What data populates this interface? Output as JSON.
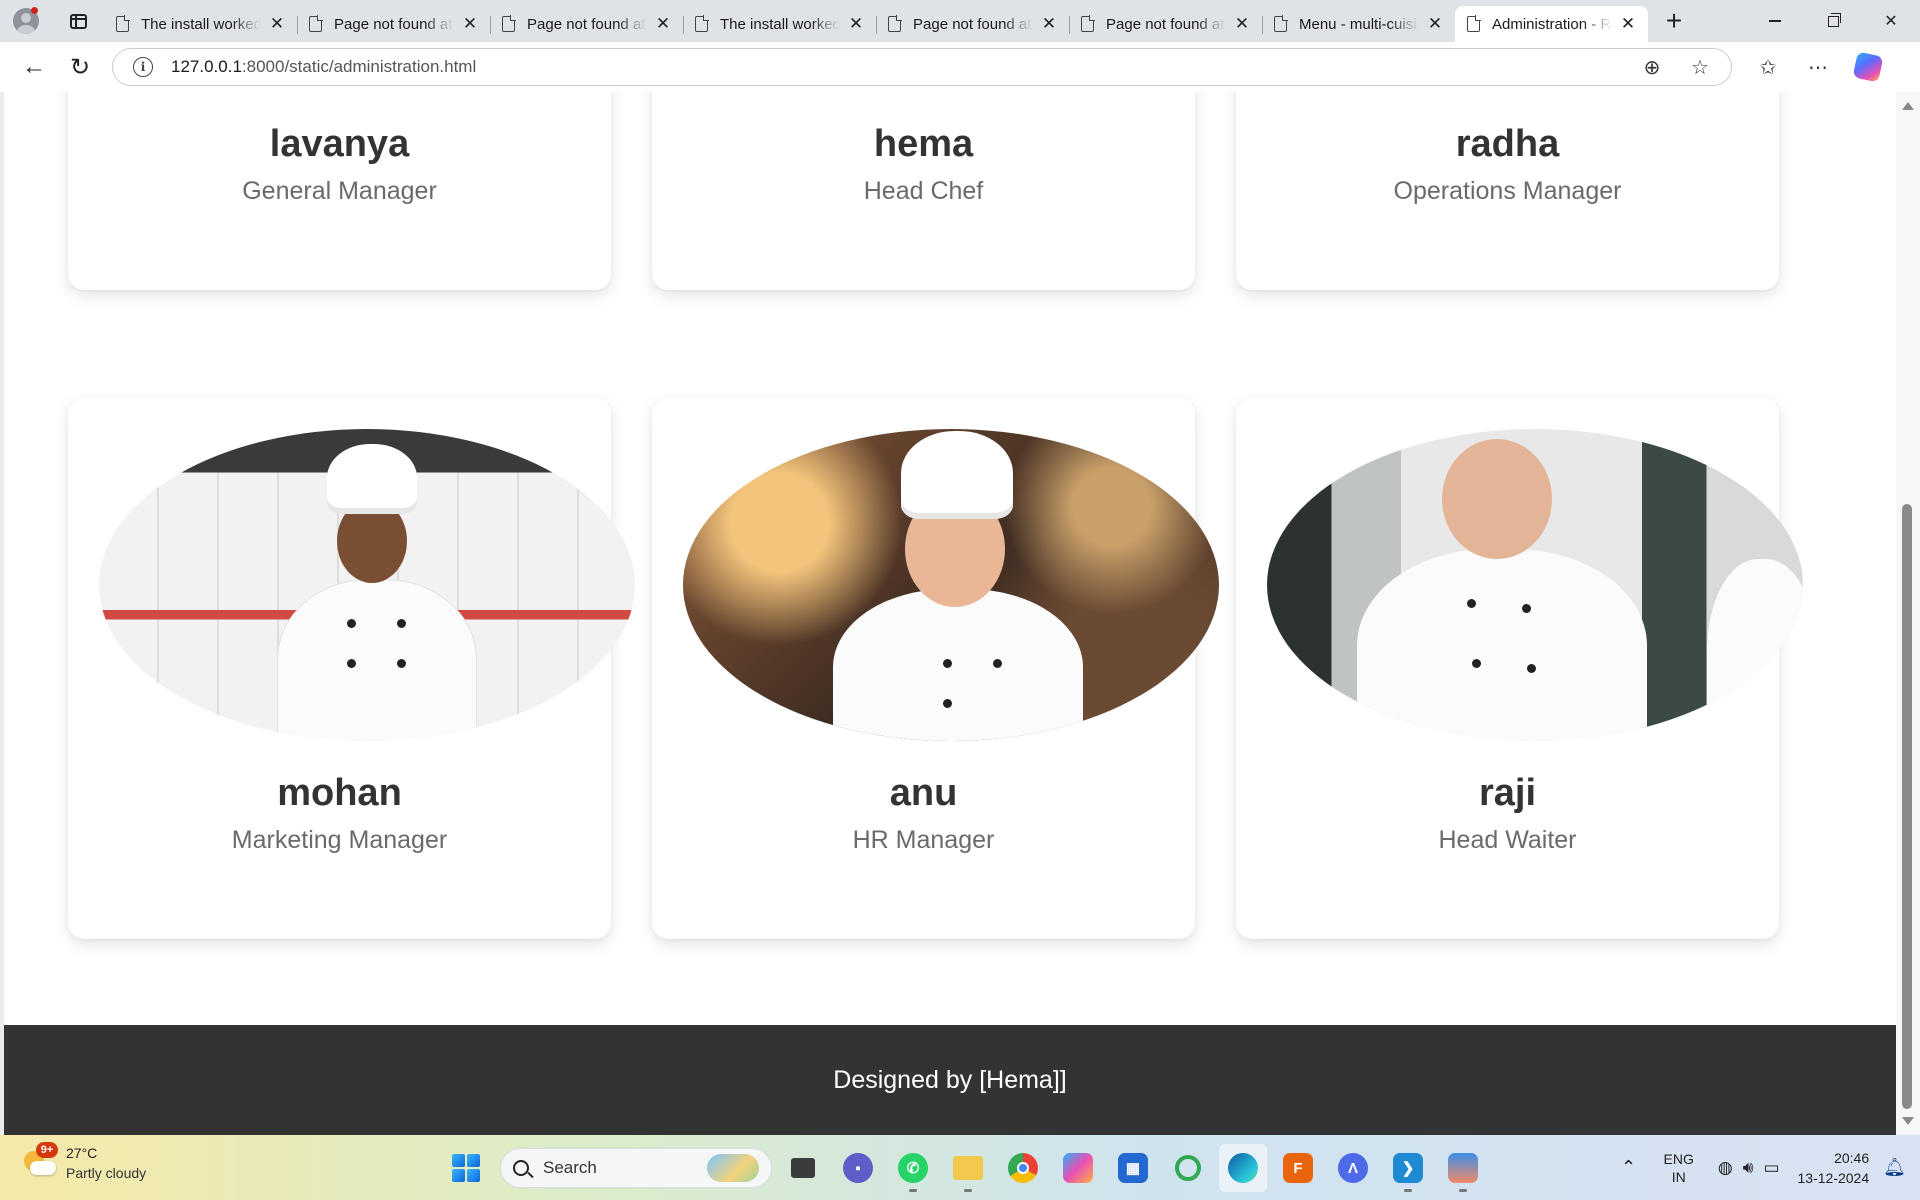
{
  "browser": {
    "tabs": [
      {
        "title": "The install worked successfully! Congratulations!",
        "active": false
      },
      {
        "title": "Page not found at /",
        "active": false
      },
      {
        "title": "Page not found at /",
        "active": false
      },
      {
        "title": "The install worked successfully! Congratulations!",
        "active": false
      },
      {
        "title": "Page not found at /",
        "active": false
      },
      {
        "title": "Page not found at /",
        "active": false
      },
      {
        "title": "Menu - multi-cuisine",
        "active": false
      },
      {
        "title": "Administration - Restaurant",
        "active": true
      }
    ],
    "close_glyph": "✕",
    "new_tab_glyph": "+",
    "address": {
      "host": "127.0.0.1",
      "rest": ":8000/static/administration.html"
    },
    "icons": {
      "back": "back-arrow-icon",
      "reload": "reload-icon",
      "site_info": "info-icon",
      "zoom": "zoom-icon",
      "favorite": "star-icon",
      "favorites": "favorites-icon",
      "more": "more-icon",
      "copilot": "copilot-icon"
    }
  },
  "team": {
    "members": [
      {
        "name": "lavanya",
        "role": "General Manager"
      },
      {
        "name": "hema",
        "role": "Head Chef"
      },
      {
        "name": "radha",
        "role": "Operations Manager"
      },
      {
        "name": "mohan",
        "role": "Marketing Manager"
      },
      {
        "name": "anu",
        "role": "HR Manager"
      },
      {
        "name": "raji",
        "role": "Head Waiter"
      }
    ]
  },
  "footer": {
    "text": "Designed by [Hema]]"
  },
  "taskbar": {
    "weather": {
      "temp": "27°C",
      "condition": "Partly cloudy",
      "badge": "9+"
    },
    "search_label": "Search",
    "apps": [
      "file-explorer-icon",
      "teams-icon",
      "whatsapp-icon",
      "folder-icon",
      "chrome-icon",
      "copilot-icon",
      "store-icon",
      "sync-icon",
      "edge-icon",
      "fuse-icon",
      "app-icon",
      "vscode-icon",
      "paint-icon"
    ],
    "language": {
      "line1": "ENG",
      "line2": "IN"
    },
    "time": "20:46",
    "date": "13-12-2024"
  }
}
